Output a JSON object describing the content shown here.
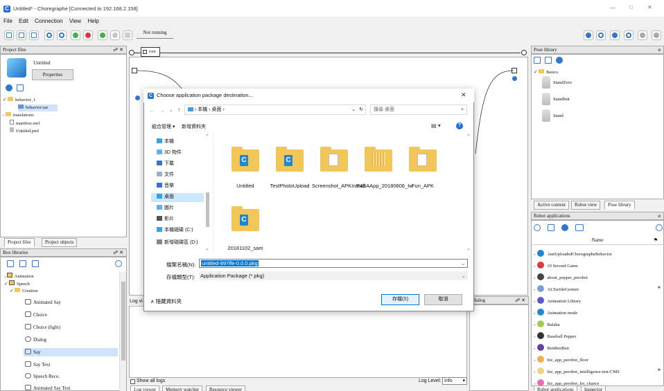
{
  "window": {
    "title": "Untitled* - Choregraphe [Connected to 192.168.2.158]",
    "controls": [
      "—",
      "□",
      "✕"
    ]
  },
  "menu": [
    "File",
    "Edit",
    "Connection",
    "View",
    "Help"
  ],
  "toolbar": {
    "status": "Not running"
  },
  "project_files": {
    "header": "Project files",
    "ctl": "☍ ✕",
    "project_name": "Untitled",
    "properties_label": "Properties",
    "tree": [
      "behavior_1",
      "behavior.xar",
      "translations",
      "manifest.xml",
      "Untitled.pml"
    ],
    "tabs": [
      "Project files",
      "Project objects"
    ]
  },
  "box_libraries": {
    "header": "Box libraries",
    "ctl": "☍ ✕",
    "tree": [
      "Animation",
      "Speech",
      "Creation"
    ],
    "items": [
      "Animated Say",
      "Choice",
      "Choice (light)",
      "Dialog",
      "Say",
      "Say Text",
      "Speech Reco.",
      "Animated Say Text"
    ]
  },
  "flow": {
    "root_label": "root"
  },
  "log": {
    "header": "Log vi",
    "show_all": "Show all logs",
    "level_label": "Log Level:",
    "level_value": "Info",
    "tabs": [
      "Log viewer",
      "Memory watcher",
      "Resource viewer"
    ]
  },
  "dialog_panel": {
    "header": "Dialog",
    "ctl": "☍ ✕"
  },
  "pose_library": {
    "header": "Pose library",
    "folder": "Basics",
    "items": [
      "StandZero",
      "StandInit",
      "Stand"
    ],
    "tabs": [
      "Active content",
      "Robot view",
      "Pose library"
    ]
  },
  "robot_apps": {
    "header": "Robot applications",
    "name_col": "Name",
    "items": [
      ".lastUploadedChoregrapheBehavior",
      "10 Second Game",
      "about_pepper_perobot",
      "ALTactileGesture",
      "Animation Library",
      "Animation mode",
      "Balaba",
      "Baseball Pepper",
      "BenBenBen",
      "biz_app_perobot_floor",
      "biz_app_perobot_intelligence-test-CMS",
      "biz_app_perobot_lot_chance"
    ],
    "tabs": [
      "Robot applications",
      "Inspector"
    ]
  },
  "file_dialog": {
    "title": "Choose application package destination...",
    "close": "✕",
    "breadcrumb": [
      "本機",
      "桌面"
    ],
    "search_placeholder": "搜尋 桌面",
    "organize": "組合管理 ▾",
    "new_folder": "新增資料夾",
    "nav": [
      "本機",
      "3D 物件",
      "下載",
      "文件",
      "音樂",
      "桌面",
      "圖片",
      "影片",
      "本機磁碟 (C:)",
      "新增磁碟區 (D:)"
    ],
    "files": [
      "Untitled",
      "TestPhotoUpload",
      "Screenshot_APKInstall",
      "P4BAApp_20180806_tw",
      "Fun_APK",
      "20181102_sam"
    ],
    "filename_label": "檔案名稱(N):",
    "filename_value": "untitled-997ffe-0.0.0.pkg",
    "filetype_label": "存檔類型(T):",
    "filetype_value": "Application Package (*.pkg)",
    "hide_folders": "隱藏資料夾",
    "save": "存檔(S)",
    "cancel": "取消"
  }
}
